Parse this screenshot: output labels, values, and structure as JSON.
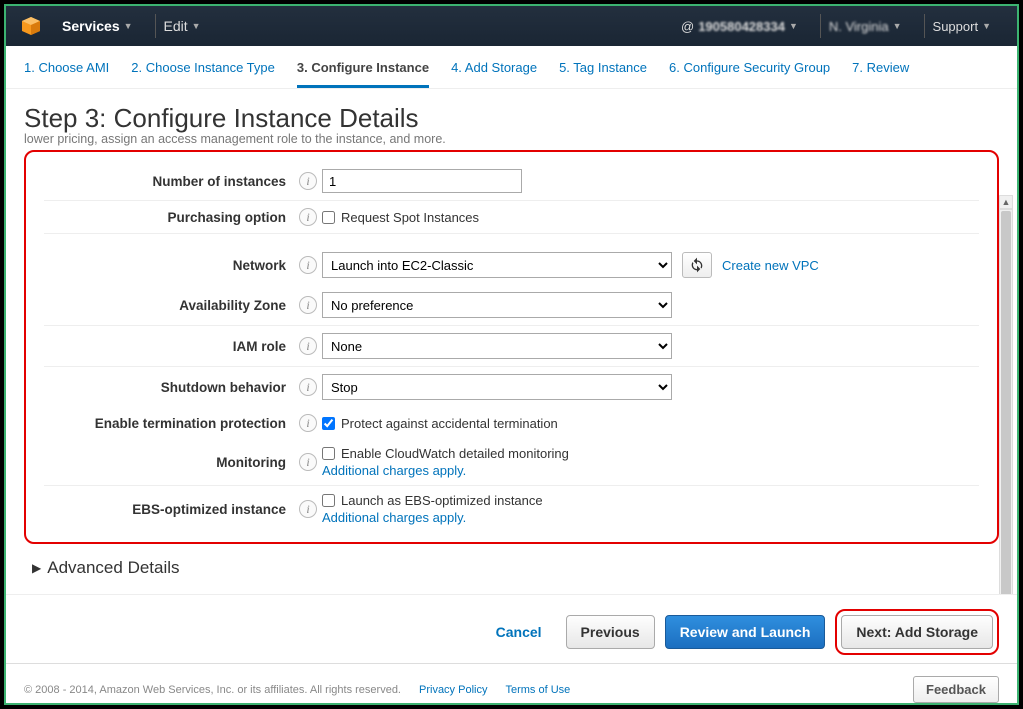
{
  "topbar": {
    "services": "Services",
    "edit": "Edit",
    "account_prefix": "@",
    "account_id": "190580428334",
    "region": "N. Virginia",
    "support": "Support"
  },
  "wizard": {
    "step1": "1. Choose AMI",
    "step2": "2. Choose Instance Type",
    "step3": "3. Configure Instance",
    "step4": "4. Add Storage",
    "step5": "5. Tag Instance",
    "step6": "6. Configure Security Group",
    "step7": "7. Review"
  },
  "page": {
    "title": "Step 3: Configure Instance Details",
    "subtitle": "lower pricing, assign an access management role to the instance, and more."
  },
  "form": {
    "num_instances_label": "Number of instances",
    "num_instances_value": "1",
    "purchasing_label": "Purchasing option",
    "purchasing_checkbox": "Request Spot Instances",
    "network_label": "Network",
    "network_value": "Launch into EC2-Classic",
    "create_vpc": "Create new VPC",
    "az_label": "Availability Zone",
    "az_value": "No preference",
    "iam_label": "IAM role",
    "iam_value": "None",
    "shutdown_label": "Shutdown behavior",
    "shutdown_value": "Stop",
    "termprot_label": "Enable termination protection",
    "termprot_checkbox": "Protect against accidental termination",
    "monitoring_label": "Monitoring",
    "monitoring_checkbox": "Enable CloudWatch detailed monitoring",
    "ebs_label": "EBS-optimized instance",
    "ebs_checkbox": "Launch as EBS-optimized instance",
    "charges_link": "Additional charges apply."
  },
  "advanced": "Advanced Details",
  "buttons": {
    "cancel": "Cancel",
    "previous": "Previous",
    "review": "Review and Launch",
    "next": "Next: Add Storage"
  },
  "footer": {
    "copyright": "© 2008 - 2014, Amazon Web Services, Inc. or its affiliates. All rights reserved.",
    "privacy": "Privacy Policy",
    "terms": "Terms of Use",
    "feedback": "Feedback"
  }
}
